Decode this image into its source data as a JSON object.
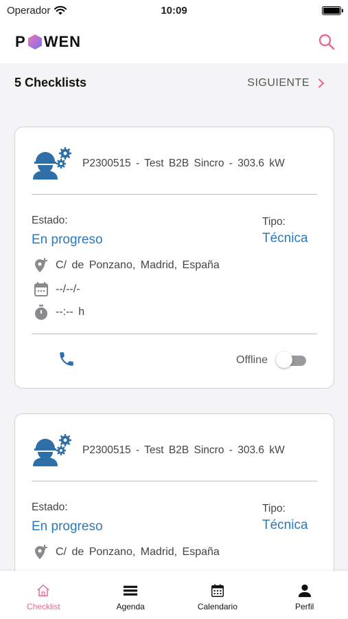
{
  "status_bar": {
    "carrier": "Operador",
    "time": "10:09"
  },
  "header": {
    "logo_left": "P",
    "logo_right": "WEN"
  },
  "section": {
    "count_title": "5 Checklists",
    "next_label": "SIGUIENTE"
  },
  "cards": [
    {
      "title": "P2300515 - Test B2B Sincro - 303.6 kW",
      "estado_label": "Estado:",
      "estado_value": "En progreso",
      "tipo_label": "Tipo:",
      "tipo_value": "Técnica",
      "address": "C/ de Ponzano, Madrid, España",
      "date": "--/--/-",
      "hours": "--:-- h",
      "offline_label": "Offline",
      "offline_enabled": false
    },
    {
      "title": "P2300515 - Test B2B Sincro - 303.6 kW",
      "estado_label": "Estado:",
      "estado_value": "En progreso",
      "tipo_label": "Tipo:",
      "tipo_value": "Técnica",
      "address": "C/ de Ponzano, Madrid, España"
    }
  ],
  "bottom_nav": [
    {
      "label": "Checklist",
      "icon": "home-icon",
      "active": true
    },
    {
      "label": "Agenda",
      "icon": "list-icon",
      "active": false
    },
    {
      "label": "Calendario",
      "icon": "calendar-icon",
      "active": false
    },
    {
      "label": "Perfil",
      "icon": "person-icon",
      "active": false
    }
  ],
  "colors": {
    "accent_pink": "#e46a8f",
    "accent_blue": "#2c78b8",
    "icon_blue": "#2f6fa8"
  }
}
